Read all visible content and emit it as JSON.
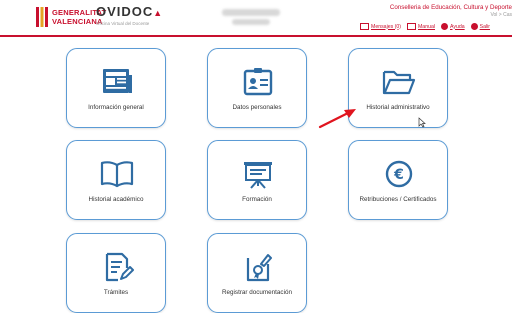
{
  "header": {
    "org_line1": "GENERALITAT",
    "org_line2": "VALENCIANA",
    "app_name": "OVIDOC",
    "app_subtitle": "Oficina Virtual del Docente",
    "department": "Conselleria de Educación, Cultura y Deporte",
    "user_info": "Vol > Cas",
    "links": [
      {
        "label": "Mensajes (0)",
        "icon": "envelope-icon"
      },
      {
        "label": "Manual",
        "icon": "book-icon"
      },
      {
        "label": "Ayuda",
        "icon": "help-icon"
      },
      {
        "label": "Salir",
        "icon": "power-icon"
      }
    ],
    "accent_color": "#c8102e"
  },
  "tiles": [
    {
      "label": "Información general",
      "icon": "newspaper-icon"
    },
    {
      "label": "Datos personales",
      "icon": "id-card-icon"
    },
    {
      "label": "Historial administrativo",
      "icon": "folder-open-icon"
    },
    {
      "label": "Historial académico",
      "icon": "open-book-icon"
    },
    {
      "label": "Formación",
      "icon": "presentation-board-icon"
    },
    {
      "label": "Retribuciones / Certificados",
      "icon": "euro-icon"
    },
    {
      "label": "Trámites",
      "icon": "document-edit-icon"
    },
    {
      "label": "Registrar documentación",
      "icon": "document-seal-icon"
    }
  ],
  "colors": {
    "tile_border": "#5b9bd5",
    "icon_color": "#2f6ca3"
  }
}
